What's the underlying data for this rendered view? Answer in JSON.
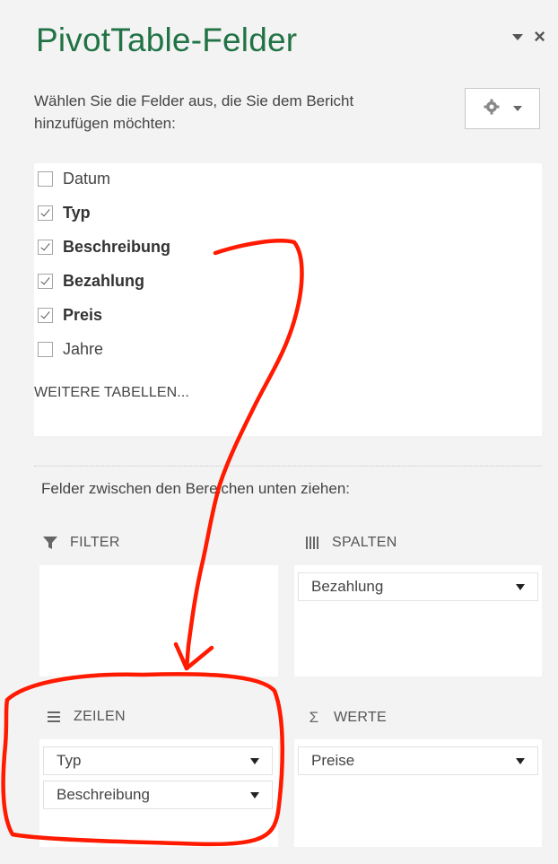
{
  "pane": {
    "title": "PivotTable-Felder"
  },
  "intro": {
    "text": "Wählen Sie die Felder aus, die Sie dem Bericht hinzufügen möchten:"
  },
  "icons": {
    "gear": "gear-icon",
    "close": "close-icon",
    "options": "chevron-down-icon"
  },
  "fields": [
    {
      "label": "Datum",
      "checked": false,
      "bold": false
    },
    {
      "label": "Typ",
      "checked": true,
      "bold": true
    },
    {
      "label": "Beschreibung",
      "checked": true,
      "bold": true
    },
    {
      "label": "Bezahlung",
      "checked": true,
      "bold": true
    },
    {
      "label": "Preis",
      "checked": true,
      "bold": true
    },
    {
      "label": "Jahre",
      "checked": false,
      "bold": false
    }
  ],
  "more_tables": "WEITERE TABELLEN...",
  "drag_hint": "Felder zwischen den Bereichen unten ziehen:",
  "areas": {
    "filter": {
      "label": "FILTER",
      "items": []
    },
    "columns": {
      "label": "SPALTEN",
      "items": [
        "Bezahlung"
      ]
    },
    "rows": {
      "label": "ZEILEN",
      "items": [
        "Typ",
        "Beschreibung"
      ]
    },
    "values": {
      "label": "WERTE",
      "items": [
        "Preise"
      ]
    }
  },
  "colors": {
    "title": "#217346",
    "annotation": "#ff1a00",
    "background": "#f3f3f3"
  }
}
